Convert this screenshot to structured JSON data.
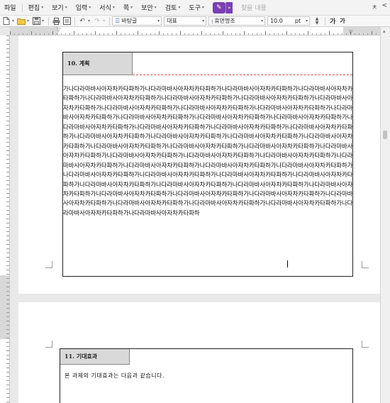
{
  "menubar": {
    "items": [
      {
        "label": "파일",
        "caret": false
      },
      {
        "label": "편집",
        "caret": true
      },
      {
        "label": "보기",
        "caret": true
      },
      {
        "label": "입력",
        "caret": true
      },
      {
        "label": "서식",
        "caret": true
      },
      {
        "label": "쪽",
        "caret": true
      },
      {
        "label": "보안",
        "caret": true
      },
      {
        "label": "검토",
        "caret": true
      },
      {
        "label": "도구",
        "caret": true
      }
    ],
    "quick_icon": "paint-icon",
    "find_placeholder": "찾을 내용",
    "right_controls": [
      "ㅊ",
      "<"
    ]
  },
  "toolbar": {
    "style_combo": "바탕글",
    "language_combo": "대표",
    "font_combo": "휴먼명조",
    "font_size": "10.0",
    "font_unit": "pt",
    "letter_wide": "가",
    "letter_narrow": "가"
  },
  "document": {
    "section10": {
      "title": "10. 계획",
      "body": "가나다라마바사아자차카타파하가나다라마바사아자차카타파하가나다라마바사아자차카타파하가나다라마바사아자차카타파하가나다라마바사아자차카타파하가나다라마바사아자차카타파하가나다라마바사아자차카타파하가나다라마바사아자차카타파하가나다라마바사아자차카타파하가나다라마바사아자차카타파하가나다라마바사아자차카타파하가나다라마바사아자차카타파하가나다라마바사아자차카타파하가나다라마바사아자차카타파하가나다라마바사아자차카타파하가나다라마바사아자차카타파하가나다라마바사아자차카타파하가나다라마바사아자차카타파하가나다라마바사아자차카타파하가나다라마바사아자차카타파하가나다라마바사아자차카타파하가나다라마바사아자차카타파하가나다라마바사아자차카타파하가나다라마바사아자차카타파하가나다라마바사아자차카타파하가나다라마바사아자차카타파하가나다라마바사아자차카타파하가나다라마바사아자차카타파하가나다라마바사아자차카타파하가나다라마바사아자차카타파하가나다라마바사아자차카타파하가나다라마바사아자차카타파하가나다라마바사아자차카타파하가나다라마바사아자차카타파하가나다라마바사아자차카타파하가나다라마바사아자차카타파하가나다라마바사아자차카타파하가나다라마바사아자차카타파하가나다라마바사아자차카타파하가나다라마바사아자차카타파하가나다라마바사아자차카타파하가나다라마바사아자차카타파하가나다라마바사아자차카타파하가나다라마바사아자차카타파하가나다라마바사아자차카타파하가나다라마바사아자차카타파하가나다라마바사아자차카타파하가나다라마바사아자차카타파하가나다라마바사아자차카타파하가나다라마바사아자차카타파하가나다라마바사아자차카타파하"
    },
    "section11": {
      "title": "11. 기대효과",
      "body": "본 과제의 기대효과는 다음과 같습니다."
    }
  }
}
